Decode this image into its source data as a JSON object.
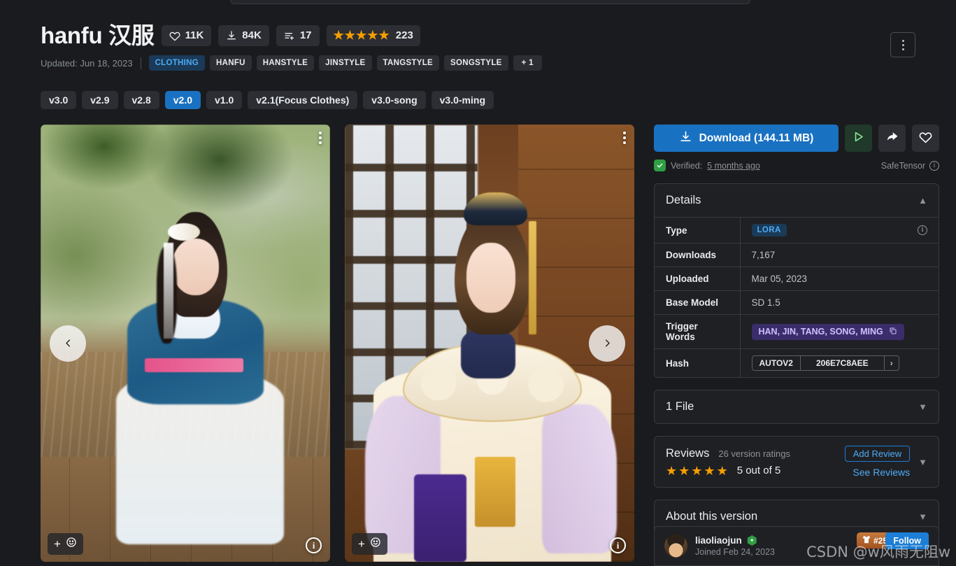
{
  "header": {
    "title": "hanfu 汉服",
    "stats": [
      {
        "icon": "heart-icon",
        "value": "11K"
      },
      {
        "icon": "download-icon",
        "value": "84K"
      },
      {
        "icon": "list-add-icon",
        "value": "17"
      }
    ],
    "rating": {
      "stars": 5,
      "count": "223"
    },
    "updated": "Updated: Jun 18, 2023",
    "tags": [
      "CLOTHING",
      "HANFU",
      "HANSTYLE",
      "JINSTYLE",
      "TANGSTYLE",
      "SONGSTYLE"
    ],
    "more_tags": "+ 1",
    "menu_icon": "kebab-menu-icon"
  },
  "versions": {
    "items": [
      "v3.0",
      "v2.9",
      "v2.8",
      "v2.0",
      "v1.0",
      "v2.1(Focus Clothes)",
      "v3.0-song",
      "v3.0-ming"
    ],
    "active": "v2.0"
  },
  "gallery": {
    "images": [
      {
        "alt": "Woman in blue and white hanfu sitting by water",
        "menu_icon": "kebab-menu-icon",
        "react_icon": "emoji-reaction-icon",
        "info_icon": "info-icon"
      },
      {
        "alt": "Woman in cream and gold hanfu indoors",
        "menu_icon": "kebab-menu-icon",
        "react_icon": "emoji-reaction-icon",
        "info_icon": "info-icon"
      }
    ],
    "prev_label": "‹",
    "next_label": "›"
  },
  "actions": {
    "download_label": "Download (144.11 MB)",
    "download_icon": "download-icon",
    "run_icon": "play-icon",
    "share_icon": "share-icon",
    "favorite_icon": "heart-icon",
    "verified_prefix": "Verified:",
    "verified_time": "5 months ago",
    "format": "SafeTensor",
    "format_info_icon": "info-icon",
    "shield_icon": "shield-check-icon"
  },
  "details": {
    "title": "Details",
    "collapse_icon": "chevron-up-icon",
    "rows": [
      {
        "key": "Type",
        "value": "LORA",
        "kind": "badge",
        "trailing_icon": "info-icon"
      },
      {
        "key": "Downloads",
        "value": "7,167",
        "kind": "text"
      },
      {
        "key": "Uploaded",
        "value": "Mar 05, 2023",
        "kind": "text"
      },
      {
        "key": "Base Model",
        "value": "SD 1.5",
        "kind": "text"
      },
      {
        "key": "Trigger Words",
        "value": "HAN, JIN, TANG, SONG, MING",
        "kind": "trigger",
        "trailing_icon": "copy-icon"
      },
      {
        "key": "Hash",
        "value": "206E7C8AEE",
        "kind": "hash",
        "algo": "AUTOV2",
        "expand": "›"
      }
    ]
  },
  "files": {
    "title": "1 File",
    "expand_icon": "chevron-down-icon"
  },
  "reviews": {
    "title": "Reviews",
    "subtitle": "26 version ratings",
    "stars": 5,
    "score_text": "5 out of 5",
    "add_review_label": "Add Review",
    "see_reviews_label": "See Reviews",
    "expand_icon": "chevron-down-icon"
  },
  "about": {
    "title": "About this version",
    "expand_icon": "chevron-down-icon"
  },
  "creator": {
    "name": "liaoliaojun",
    "verified_icon": "verified-hex-icon",
    "joined": "Joined Feb 24, 2023",
    "rank_badge": "#25",
    "rank_icon": "shirt-icon",
    "follow_label": "Follow",
    "avatar_icon": "avatar"
  },
  "watermark": "CSDN @w风雨无阻w",
  "colors": {
    "accent_blue": "#1971c2",
    "link_blue": "#4dabf7",
    "star_orange": "#f59f00",
    "verified_green": "#2f9e44",
    "trigger_purple": "#3b2d6b",
    "page_bg": "#1a1b1e",
    "card_bg": "#1f2024",
    "border": "#373a40"
  }
}
